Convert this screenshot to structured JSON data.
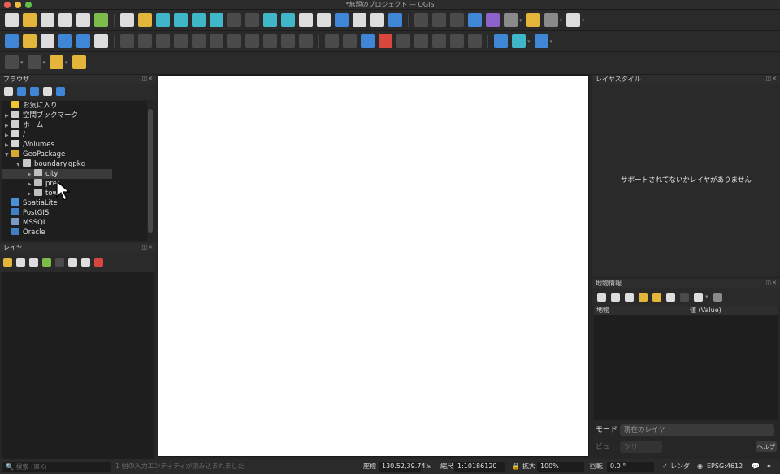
{
  "window": {
    "title": "*無題のプロジェクト — QGIS"
  },
  "browser_panel": {
    "title": "ブラウザ",
    "items": [
      {
        "label": "お気に入り",
        "icon": "star-icon",
        "depth": 0,
        "expanded": false
      },
      {
        "label": "空間ブックマーク",
        "icon": "bookmark-icon",
        "depth": 0,
        "expanded": false
      },
      {
        "label": "ホーム",
        "icon": "home-folder-icon",
        "depth": 0,
        "expanded": false
      },
      {
        "label": "/",
        "icon": "folder-icon",
        "depth": 0,
        "expanded": false
      },
      {
        "label": "/Volumes",
        "icon": "folder-icon",
        "depth": 0,
        "expanded": false
      },
      {
        "label": "GeoPackage",
        "icon": "geopackage-icon",
        "depth": 0,
        "expanded": true
      },
      {
        "label": "boundary.gpkg",
        "icon": "database-icon",
        "depth": 1,
        "expanded": true
      },
      {
        "label": "city",
        "icon": "polygon-layer-icon",
        "depth": 2,
        "expanded": false,
        "selected": true
      },
      {
        "label": "pref",
        "icon": "polygon-layer-icon",
        "depth": 2,
        "expanded": false
      },
      {
        "label": "town",
        "icon": "polygon-layer-icon",
        "depth": 2,
        "expanded": false
      },
      {
        "label": "SpatiaLite",
        "icon": "spatialite-icon",
        "depth": 0,
        "expanded": false
      },
      {
        "label": "PostGIS",
        "icon": "postgis-icon",
        "depth": 0,
        "expanded": false
      },
      {
        "label": "MSSQL",
        "icon": "mssql-icon",
        "depth": 0,
        "expanded": false
      },
      {
        "label": "Oracle",
        "icon": "oracle-icon",
        "depth": 0,
        "expanded": false
      }
    ]
  },
  "layers_panel": {
    "title": "レイヤ"
  },
  "layer_style_panel": {
    "title": "レイヤスタイル",
    "message": "サポートされてないかレイヤがありません"
  },
  "feature_info_panel": {
    "title": "地物情報",
    "columns": [
      "地物",
      "値 (Value)"
    ],
    "mode_label": "モード",
    "mode_value": "現在のレイヤ",
    "view_label": "ビュー",
    "view_value": "ツリー",
    "help_label": "ヘルプ"
  },
  "statusbar": {
    "search_placeholder": "検索 (⌘K)",
    "message": "1 個の入力エンティティが読み込まれました",
    "coord_label": "座標",
    "coord_value": "130.52,39.74",
    "scale_label": "縮尺",
    "scale_value": "1:10186120",
    "magnifier_label": "拡大",
    "magnifier_value": "100%",
    "rotation_label": "回転",
    "rotation_value": "0.0 °",
    "render_label": "レンダ",
    "crs_label": "EPSG:4612"
  },
  "colors": {
    "panel_bg": "#262626",
    "tree_bg": "#1e1e1e",
    "map_canvas": "#ffffff"
  }
}
